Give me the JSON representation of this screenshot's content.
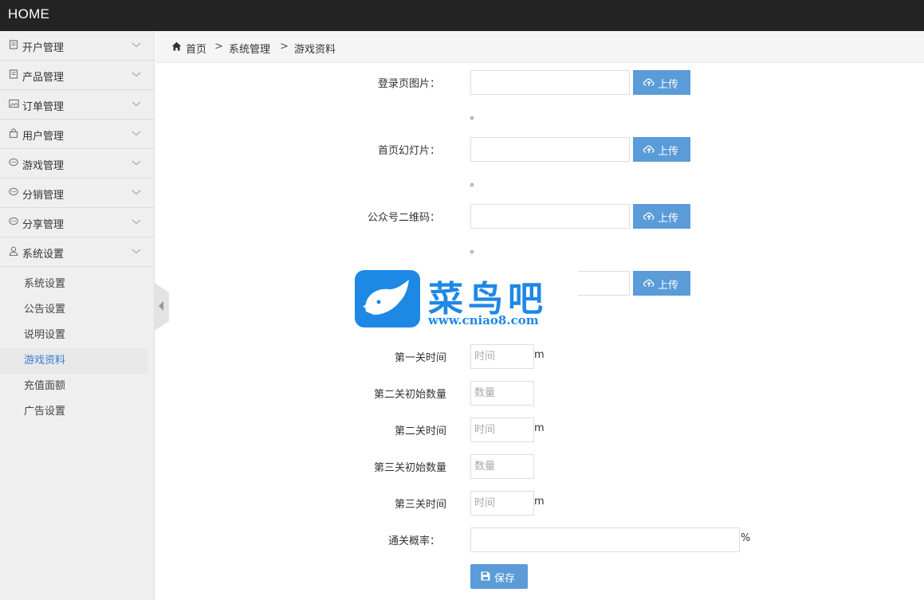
{
  "app": {
    "brand": "HOME"
  },
  "sidebar": {
    "items": [
      {
        "label": "开户管理",
        "icon": "book-icon"
      },
      {
        "label": "产品管理",
        "icon": "book-icon"
      },
      {
        "label": "订单管理",
        "icon": "image-icon"
      },
      {
        "label": "用户管理",
        "icon": "bag-icon"
      },
      {
        "label": "游戏管理",
        "icon": "chat-icon"
      },
      {
        "label": "分销管理",
        "icon": "chat-icon"
      },
      {
        "label": "分享管理",
        "icon": "chat-icon"
      },
      {
        "label": "系统设置",
        "icon": "user-icon"
      }
    ],
    "submenu": [
      {
        "label": "系统设置"
      },
      {
        "label": "公告设置"
      },
      {
        "label": "说明设置"
      },
      {
        "label": "游戏资料",
        "active": true
      },
      {
        "label": "充值面额"
      },
      {
        "label": "广告设置"
      }
    ]
  },
  "breadcrumb": {
    "home": "首页",
    "section": "系统管理",
    "current": "游戏资料",
    "separator": ">"
  },
  "form": {
    "uploads": [
      {
        "label": "登录页图片：",
        "button": "上传"
      },
      {
        "label": "首页幻灯片：",
        "button": "上传"
      },
      {
        "label": "公众号二维码：",
        "button": "上传"
      },
      {
        "label": "",
        "button": "上传"
      }
    ],
    "fields": [
      {
        "label": "第一关时间",
        "placeholder": "时间",
        "unit": "m"
      },
      {
        "label": "第二关初始数量",
        "placeholder": "数量",
        "unit": ""
      },
      {
        "label": "第二关时间",
        "placeholder": "时间",
        "unit": "m"
      },
      {
        "label": "第三关初始数量",
        "placeholder": "数量",
        "unit": ""
      },
      {
        "label": "第三关时间",
        "placeholder": "时间",
        "unit": "m"
      }
    ],
    "pass_rate": {
      "label": "通关概率：",
      "unit": "%"
    },
    "save_label": "保存"
  },
  "watermark": {
    "title": "菜鸟吧",
    "url": "www.cniao8.com"
  },
  "colors": {
    "accent": "#5a9bd8",
    "topbar": "#232323",
    "watermark": "#1e88e5"
  }
}
